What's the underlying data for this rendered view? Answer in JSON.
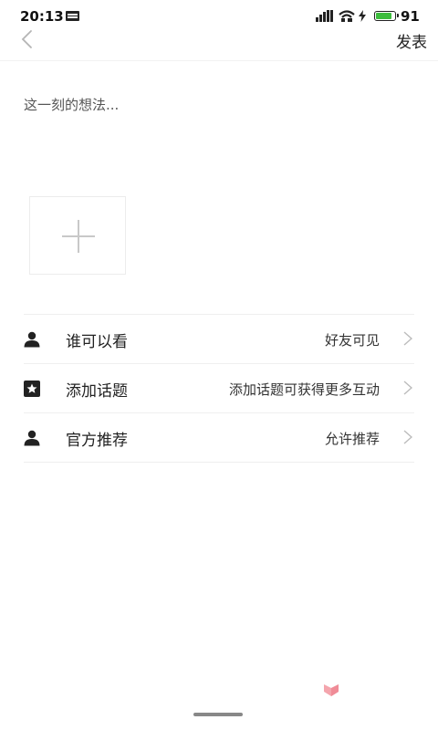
{
  "status_bar": {
    "time": "20:13",
    "battery_level": "91",
    "battery_fraction": 0.91,
    "icons": [
      "news-icon",
      "signal-icon",
      "wifi-icon",
      "charge-icon",
      "battery-icon"
    ]
  },
  "header": {
    "back_icon": "chevron-left-icon",
    "publish_label": "发表"
  },
  "editor": {
    "placeholder": "这一刻的想法...",
    "value": ""
  },
  "add_image": {
    "icon": "plus-icon"
  },
  "settings": [
    {
      "icon": "person-icon",
      "label": "谁可以看",
      "value": "好友可见"
    },
    {
      "icon": "star-badge-icon",
      "label": "添加话题",
      "value": "添加话题可获得更多互动"
    },
    {
      "icon": "person-icon",
      "label": "官方推荐",
      "value": "允许推荐"
    }
  ],
  "colors": {
    "text": "#222222",
    "divider": "#efefef",
    "chevron": "#bbbbbb",
    "battery_fill": "#3dbd3d",
    "badge": "#f4a5ad"
  }
}
